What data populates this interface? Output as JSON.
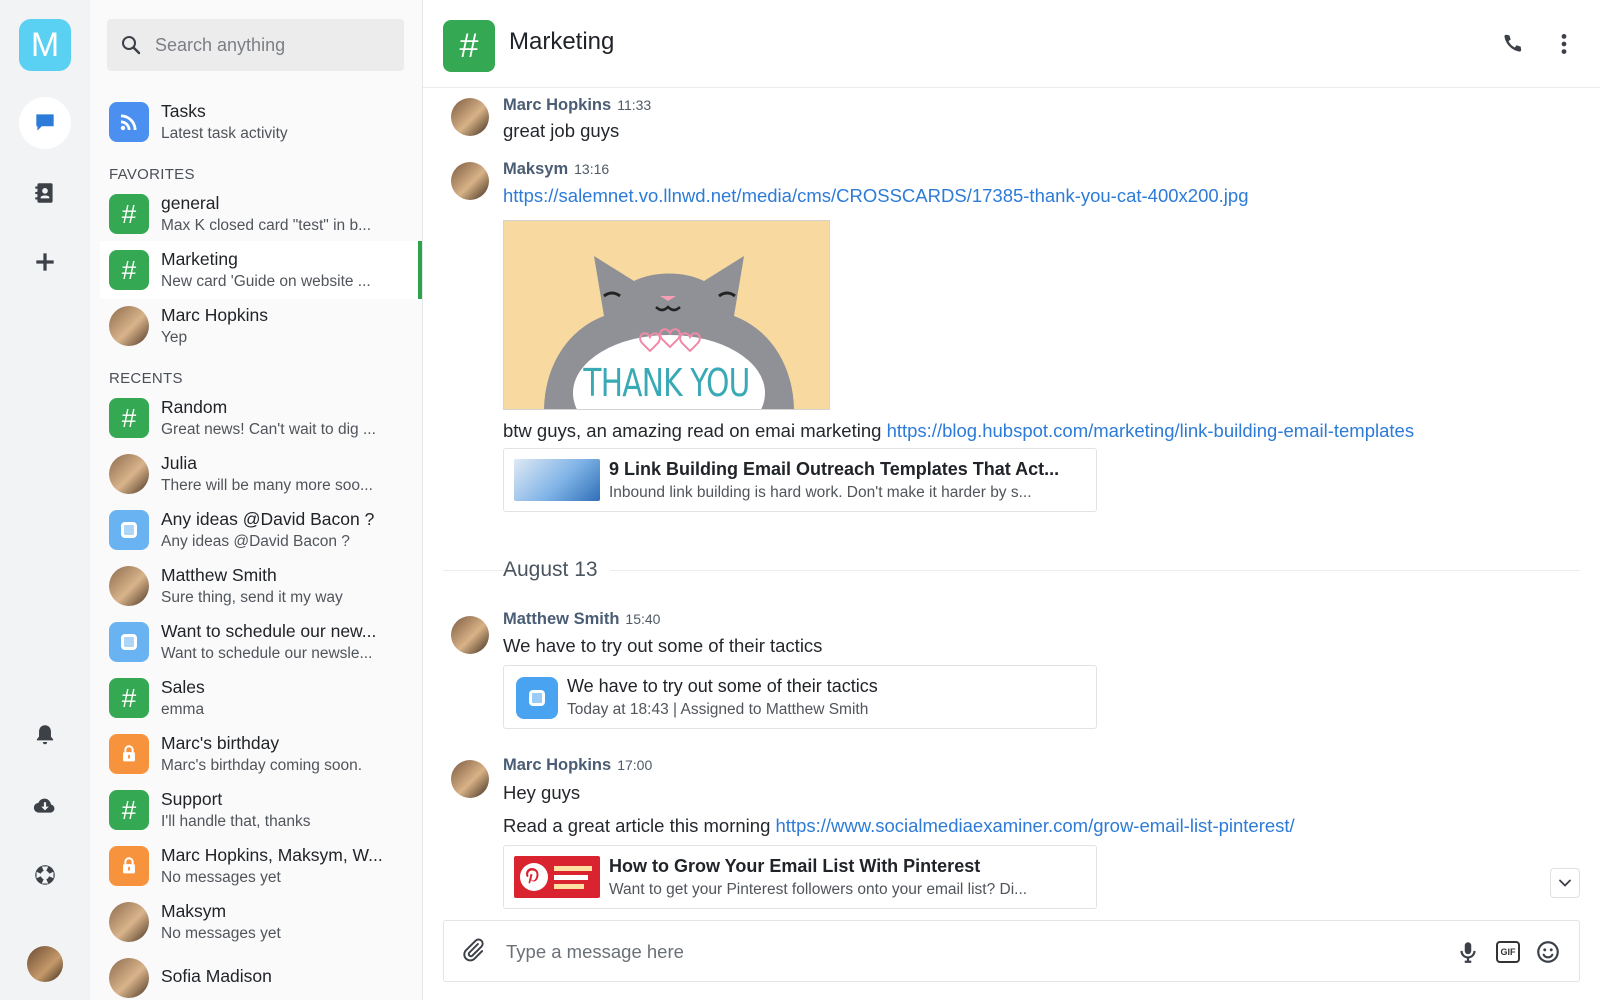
{
  "app": {
    "logo_letter": "M"
  },
  "search": {
    "placeholder": "Search anything"
  },
  "sections": {
    "favorites": "FAVORITES",
    "recents": "RECENTS"
  },
  "conversations": {
    "tasks": {
      "title": "Tasks",
      "subtitle": "Latest task activity"
    },
    "favorites": [
      {
        "title": "general",
        "subtitle": "Max K closed card \"test\" in b...",
        "icon": "hash"
      },
      {
        "title": "Marketing",
        "subtitle": "New card 'Guide on website ...",
        "icon": "hash"
      },
      {
        "title": "Marc Hopkins",
        "subtitle": "Yep",
        "icon": "avatar"
      }
    ],
    "recents": [
      {
        "title": "Random",
        "subtitle": "Great news! Can't wait to dig ...",
        "icon": "hash"
      },
      {
        "title": "Julia",
        "subtitle": "There will be many more soo...",
        "icon": "avatar"
      },
      {
        "title": "Any ideas @David Bacon ?",
        "subtitle": "Any ideas @David Bacon ?",
        "icon": "task"
      },
      {
        "title": "Matthew Smith",
        "subtitle": "Sure thing, send it my way",
        "icon": "avatar"
      },
      {
        "title": "Want to schedule our new...",
        "subtitle": "Want to schedule our newsle...",
        "icon": "task"
      },
      {
        "title": "Sales",
        "subtitle": "emma",
        "icon": "hash"
      },
      {
        "title": "Marc's birthday",
        "subtitle": "Marc's birthday coming soon.",
        "icon": "lock"
      },
      {
        "title": "Support",
        "subtitle": "I'll handle that, thanks",
        "icon": "hash"
      },
      {
        "title": "Marc Hopkins, Maksym, W...",
        "subtitle": "No messages yet",
        "icon": "lock"
      },
      {
        "title": "Maksym",
        "subtitle": "No messages yet",
        "icon": "avatar"
      },
      {
        "title": "Sofia Madison",
        "subtitle": "",
        "icon": "avatar"
      }
    ]
  },
  "channel": {
    "title": "Marketing",
    "icon": "#"
  },
  "messages": {
    "m1": {
      "author": "Marc Hopkins",
      "time": "11:33",
      "text": "great job guys"
    },
    "m2": {
      "author": "Maksym",
      "time": "13:16",
      "link": "https://salemnet.vo.llnwd.net/media/cms/CROSSCARDS/17385-thank-you-cat-400x200.jpg",
      "image_text": "THANK YOU",
      "text2": "btw guys, an amazing read on emai marketing",
      "link2": "https://blog.hubspot.com/marketing/link-building-email-templates",
      "preview_title": "9 Link Building Email Outreach Templates That Act...",
      "preview_desc": "Inbound link building is hard work. Don't make it harder by s..."
    },
    "date_divider": "August 13",
    "m3": {
      "author": "Matthew Smith",
      "time": "15:40",
      "text": "We have to try out some of their tactics",
      "task_title": "We have to try out some of their tactics",
      "task_time": "Today at 18:43",
      "task_sep": "|",
      "task_assigned": "Assigned to",
      "task_assignee": "Matthew Smith"
    },
    "m4": {
      "author": "Marc Hopkins",
      "time": "17:00",
      "text": "Hey guys",
      "text2": "Read a great article this morning",
      "link2": "https://www.socialmediaexaminer.com/grow-email-list-pinterest/",
      "preview_title": "How to Grow Your Email List With Pinterest",
      "preview_desc": "Want to get your Pinterest followers onto your email list? Di..."
    }
  },
  "composer": {
    "placeholder": "Type a message here"
  },
  "colors": {
    "accent_green": "#34a853",
    "link_blue": "#2d7bd8",
    "logo_cyan": "#5ad0f3"
  }
}
